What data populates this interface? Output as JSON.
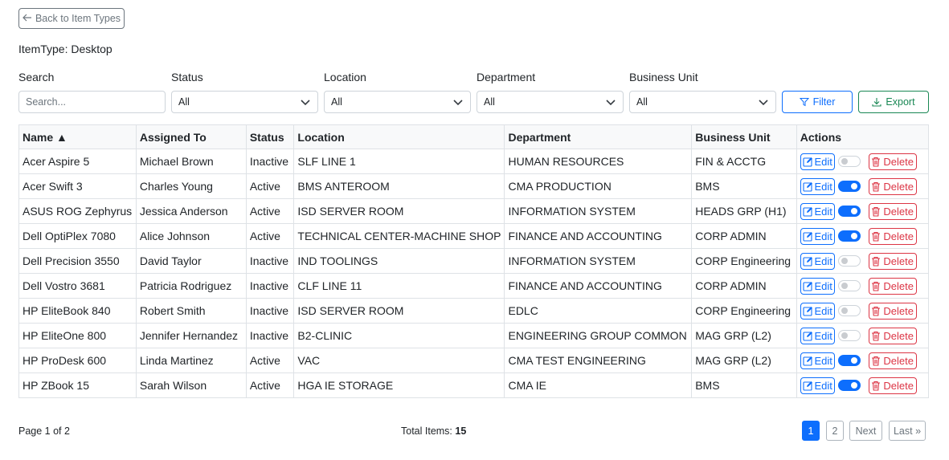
{
  "back_button": {
    "label": "Back to Item Types"
  },
  "item_type": "ItemType: Desktop",
  "filters": {
    "search_label": "Search",
    "search_placeholder": "Search...",
    "status_label": "Status",
    "status_value": "All",
    "location_label": "Location",
    "location_value": "All",
    "department_label": "Department",
    "department_value": "All",
    "business_unit_label": "Business Unit",
    "business_unit_value": "All",
    "filter_button": "Filter",
    "export_button": "Export"
  },
  "table": {
    "headers": [
      "Name ▲",
      "Assigned To",
      "Status",
      "Location",
      "Department",
      "Business Unit",
      "Actions"
    ],
    "edit_label": "Edit",
    "delete_label": "Delete",
    "rows": [
      {
        "name": "Acer Aspire 5",
        "assigned": "Michael Brown",
        "status": "Inactive",
        "location": "SLF LINE 1",
        "department": "HUMAN RESOURCES",
        "bu": "FIN & ACCTG",
        "active": false
      },
      {
        "name": "Acer Swift 3",
        "assigned": "Charles Young",
        "status": "Active",
        "location": "BMS ANTEROOM",
        "department": "CMA PRODUCTION",
        "bu": "BMS",
        "active": true
      },
      {
        "name": "ASUS ROG Zephyrus",
        "assigned": "Jessica Anderson",
        "status": "Active",
        "location": "ISD SERVER ROOM",
        "department": "INFORMATION SYSTEM",
        "bu": "HEADS GRP (H1)",
        "active": true
      },
      {
        "name": "Dell OptiPlex 7080",
        "assigned": "Alice Johnson",
        "status": "Active",
        "location": "TECHNICAL CENTER-MACHINE SHOP",
        "department": "FINANCE AND ACCOUNTING",
        "bu": "CORP ADMIN",
        "active": true
      },
      {
        "name": "Dell Precision 3550",
        "assigned": "David Taylor",
        "status": "Inactive",
        "location": "IND TOOLINGS",
        "department": "INFORMATION SYSTEM",
        "bu": "CORP Engineering",
        "active": false
      },
      {
        "name": "Dell Vostro 3681",
        "assigned": "Patricia Rodriguez",
        "status": "Inactive",
        "location": "CLF LINE 11",
        "department": "FINANCE AND ACCOUNTING",
        "bu": "CORP ADMIN",
        "active": false
      },
      {
        "name": "HP EliteBook 840",
        "assigned": "Robert Smith",
        "status": "Inactive",
        "location": "ISD SERVER ROOM",
        "department": "EDLC",
        "bu": "CORP Engineering",
        "active": false
      },
      {
        "name": "HP EliteOne 800",
        "assigned": "Jennifer Hernandez",
        "status": "Inactive",
        "location": "B2-CLINIC",
        "department": "ENGINEERING GROUP COMMON",
        "bu": "MAG GRP (L2)",
        "active": false
      },
      {
        "name": "HP ProDesk 600",
        "assigned": "Linda Martinez",
        "status": "Active",
        "location": "VAC",
        "department": "CMA TEST ENGINEERING",
        "bu": "MAG GRP (L2)",
        "active": true
      },
      {
        "name": "HP ZBook 15",
        "assigned": "Sarah Wilson",
        "status": "Active",
        "location": "HGA IE STORAGE",
        "department": "CMA IE",
        "bu": "BMS",
        "active": true
      }
    ]
  },
  "pagination": {
    "page_info": "Page 1 of 2",
    "total_label": "Total Items:",
    "total_value": "15",
    "page1": "1",
    "page2": "2",
    "next": "Next",
    "last": "Last »"
  },
  "colors": {
    "primary": "#0d6efd",
    "success": "#198754",
    "danger": "#dc3545",
    "secondary": "#6c757d"
  }
}
